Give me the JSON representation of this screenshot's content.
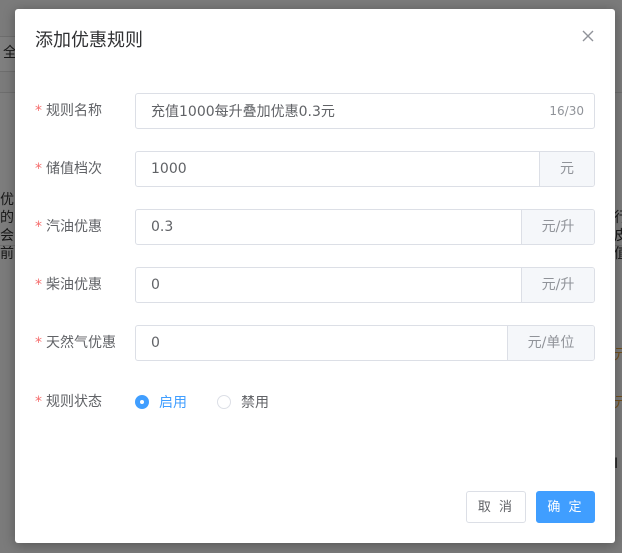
{
  "background": {
    "fragments": [
      {
        "text": "全"
      },
      {
        "text": "优"
      },
      {
        "text": "的"
      },
      {
        "text": "会"
      },
      {
        "text": "前"
      },
      {
        "text": "行"
      },
      {
        "text": "皮"
      },
      {
        "text": "值"
      },
      {
        "text": "元"
      },
      {
        "text": "元"
      },
      {
        "text": "I"
      }
    ]
  },
  "dialog": {
    "title": "添加优惠规则",
    "close_icon": "close-icon",
    "fields": {
      "rule_name": {
        "label": "规则名称",
        "required_mark": "*",
        "value": "充值1000每升叠加优惠0.3元",
        "count": "16/30"
      },
      "recharge_level": {
        "label": "储值档次",
        "required_mark": "*",
        "value": "1000",
        "unit": "元"
      },
      "gasoline_discount": {
        "label": "汽油优惠",
        "required_mark": "*",
        "value": "0.3",
        "unit": "元/升"
      },
      "diesel_discount": {
        "label": "柴油优惠",
        "required_mark": "*",
        "value": "0",
        "unit": "元/升"
      },
      "natural_gas_discount": {
        "label": "天然气优惠",
        "required_mark": "*",
        "value": "0",
        "unit": "元/单位"
      },
      "rule_status": {
        "label": "规则状态",
        "required_mark": "*",
        "options": [
          {
            "label": "启用",
            "checked": true
          },
          {
            "label": "禁用",
            "checked": false
          }
        ]
      }
    },
    "buttons": {
      "cancel": "取 消",
      "confirm": "确 定"
    }
  },
  "colors": {
    "primary": "#409eff",
    "required": "#f56c6c",
    "border": "#dcdfe6"
  }
}
